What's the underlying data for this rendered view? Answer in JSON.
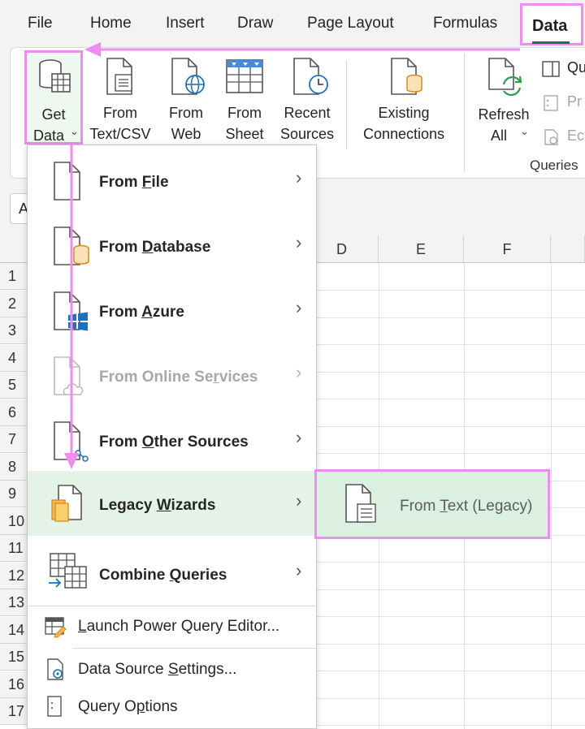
{
  "menu_tabs": [
    {
      "label": "File"
    },
    {
      "label": "Home"
    },
    {
      "label": "Insert"
    },
    {
      "label": "Draw"
    },
    {
      "label": "Page Layout"
    },
    {
      "label": "Formulas"
    }
  ],
  "active_tab": "Data",
  "ribbon": {
    "get_data": {
      "line1": "Get",
      "line2": "Data",
      "icon": "database-grid-icon"
    },
    "from_text_csv": {
      "line1": "From",
      "line2": "Text/CSV",
      "icon": "text-file-icon"
    },
    "from_web": {
      "line1": "From",
      "line2": "Web",
      "icon": "web-globe-icon"
    },
    "from_sheet": {
      "line1": "From",
      "line2": "Sheet",
      "icon": "table-icon"
    },
    "recent_sources": {
      "line1": "Recent",
      "line2": "Sources",
      "icon": "clock-file-icon"
    },
    "existing_connections": {
      "line1": "Existing",
      "line2": "Connections",
      "icon": "connection-file-icon"
    },
    "refresh_all": {
      "line1": "Refresh",
      "line2": "All",
      "icon": "refresh-icon"
    },
    "queries_group_label": "Queries",
    "side_items": [
      {
        "label": "Qu",
        "icon": "queries-pane-icon"
      },
      {
        "label": "Pr",
        "icon": "properties-icon"
      },
      {
        "label": "Ec",
        "icon": "edit-links-icon"
      }
    ]
  },
  "namebox_text": "A",
  "columns": [
    "D",
    "E",
    "F"
  ],
  "rows": [
    "1",
    "2",
    "3",
    "4",
    "5",
    "6",
    "7",
    "8",
    "9",
    "10",
    "11",
    "12",
    "13",
    "14",
    "15",
    "16",
    "17"
  ],
  "dropdown": {
    "from_file": {
      "pre": "From ",
      "ul": "F",
      "post": "ile",
      "icon": "file-icon"
    },
    "from_database": {
      "pre": "From ",
      "ul": "D",
      "post": "atabase",
      "icon": "database-file-icon"
    },
    "from_azure": {
      "pre": "From ",
      "ul": "A",
      "post": "zure",
      "icon": "azure-windows-icon"
    },
    "from_online": {
      "pre": "From Online Se",
      "ul": "r",
      "post": "vices",
      "icon": "cloud-file-icon"
    },
    "from_other": {
      "pre": "From ",
      "ul": "O",
      "post": "ther Sources",
      "icon": "network-file-icon"
    },
    "legacy_wizards": {
      "pre": "Legacy ",
      "ul": "W",
      "post": "izards",
      "icon": "legacy-files-icon"
    },
    "combine_queries": {
      "pre": "Combine ",
      "ul": "Q",
      "post": "ueries",
      "icon": "combine-tables-icon"
    },
    "launch_pq": {
      "pre": "",
      "ul": "L",
      "post": "aunch Power Query Editor...",
      "icon": "power-query-editor-icon"
    },
    "data_source_settings": {
      "pre": "Data Source ",
      "ul": "S",
      "post": "ettings...",
      "icon": "data-source-settings-icon"
    },
    "query_options": {
      "pre": "Query O",
      "ul": "p",
      "post": "tions",
      "icon": "query-options-icon"
    },
    "chevron": "›"
  },
  "submenu": {
    "from_text_legacy": {
      "pre": "From ",
      "ul": "T",
      "post": "ext (Legacy)",
      "icon": "text-file-icon"
    }
  },
  "colors": {
    "annotation": "#ee8cf0",
    "highlight_row": "#e4f2e7",
    "submenu_bg": "#dbf0e0",
    "excel_green": "#217346"
  }
}
